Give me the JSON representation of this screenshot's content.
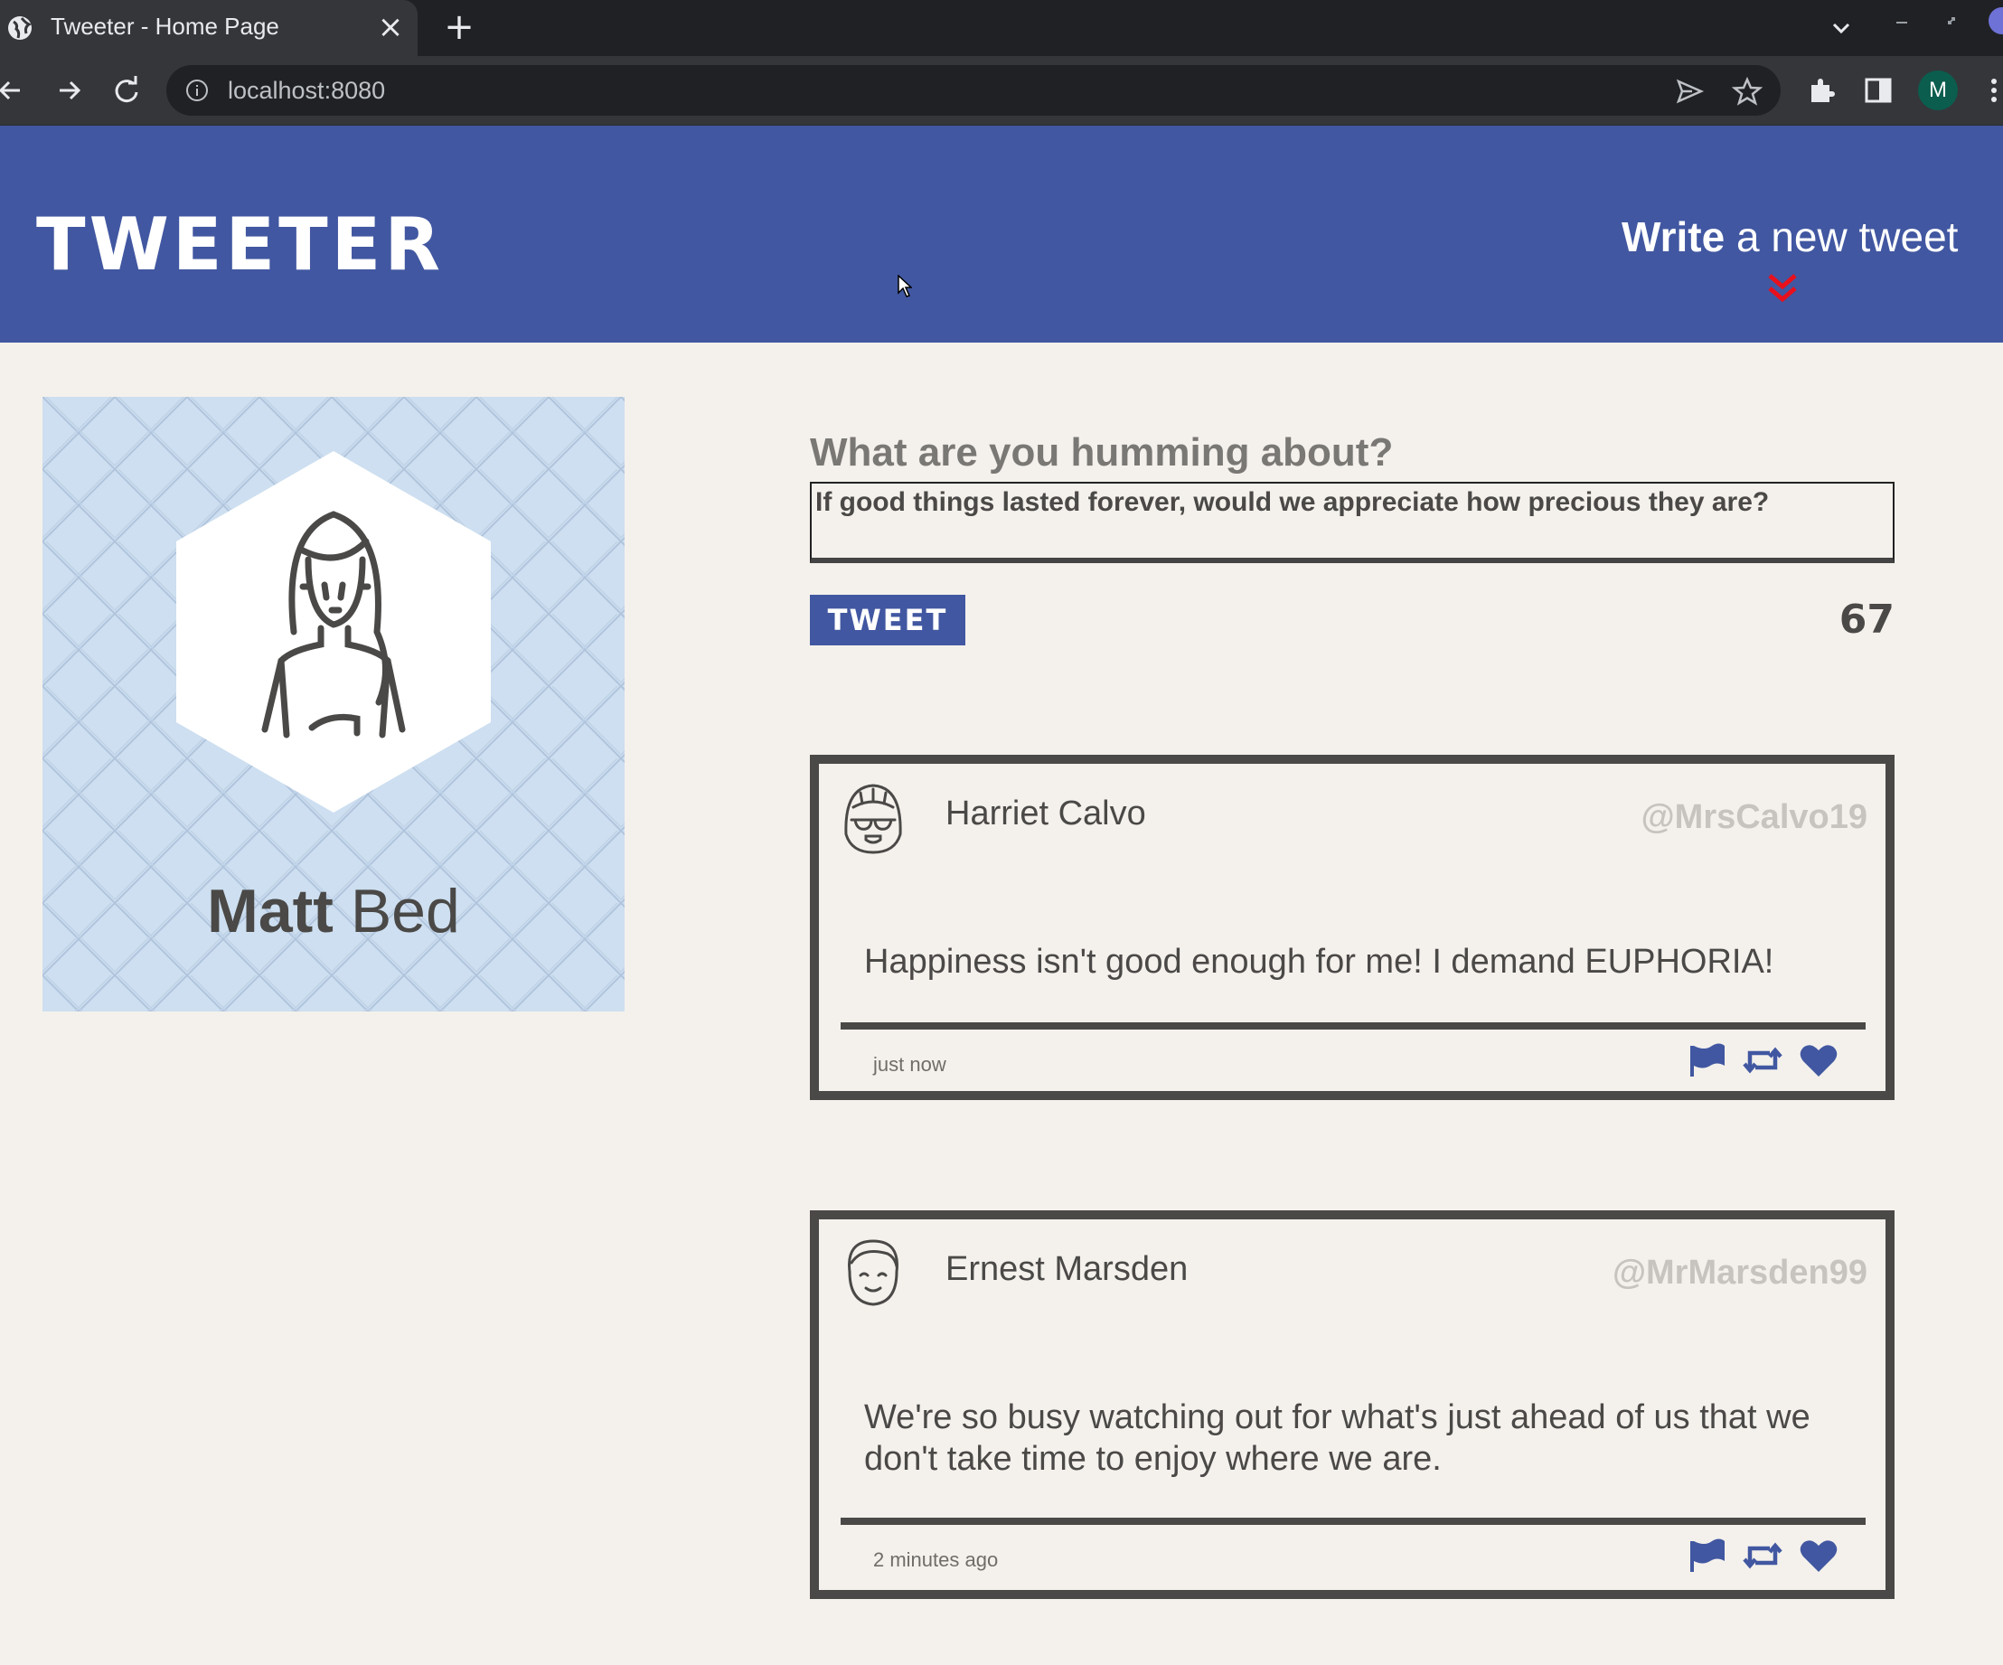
{
  "browser": {
    "tab_title": "Tweeter - Home Page",
    "url": "localhost:8080",
    "profile_initial": "M"
  },
  "header": {
    "logo": "TWEETER",
    "write_bold": "Write",
    "write_rest": " a new tweet"
  },
  "profile": {
    "first_name": "Matt",
    "last_name": " Bed"
  },
  "compose": {
    "label": "What are you humming about?",
    "text": "If good things lasted forever, would we appreciate how precious they are?",
    "button_label": "TWEET",
    "counter": "67"
  },
  "tweets": [
    {
      "author": "Harriet Calvo",
      "handle": "@MrsCalvo19",
      "body": "Happiness isn't good enough for me! I demand EUPHORIA!",
      "time": "just now"
    },
    {
      "author": "Ernest Marsden",
      "handle": "@MrMarsden99",
      "body": "We're so busy watching out for what's just ahead of us that we don't take time to enjoy where we are.",
      "time": "2 minutes ago"
    }
  ],
  "colors": {
    "brand_blue": "#4157a1",
    "page_bg": "#f4f1ec",
    "text_dark": "#4a4947",
    "profile_bg": "#cddff0",
    "accent_red": "#e8101c"
  }
}
